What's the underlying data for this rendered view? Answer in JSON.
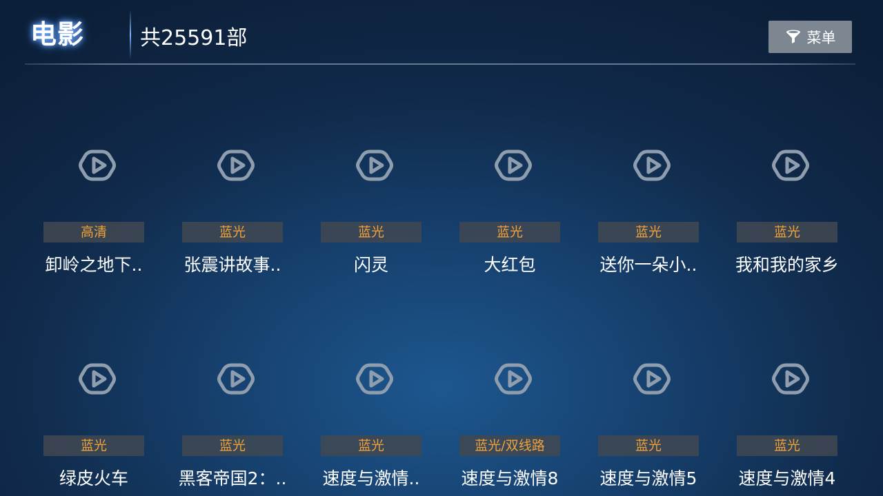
{
  "header": {
    "title": "电影",
    "count": "共25591部",
    "menu_label": "菜单"
  },
  "movies": [
    {
      "badge": "高清",
      "title": "卸岭之地下.."
    },
    {
      "badge": "蓝光",
      "title": "张震讲故事.."
    },
    {
      "badge": "蓝光",
      "title": "闪灵"
    },
    {
      "badge": "蓝光",
      "title": "大红包"
    },
    {
      "badge": "蓝光",
      "title": "送你一朵小.."
    },
    {
      "badge": "蓝光",
      "title": "我和我的家乡"
    },
    {
      "badge": "蓝光",
      "title": "绿皮火车"
    },
    {
      "badge": "蓝光",
      "title": "黑客帝国2：.."
    },
    {
      "badge": "蓝光",
      "title": "速度与激情.."
    },
    {
      "badge": "蓝光/双线路",
      "title": "速度与激情8"
    },
    {
      "badge": "蓝光",
      "title": "速度与激情5"
    },
    {
      "badge": "蓝光",
      "title": "速度与激情4"
    }
  ],
  "colors": {
    "badge_text": "#f0a23a",
    "icon": "#8f9eae"
  },
  "icons": {
    "menu": "filter-icon",
    "poster_placeholder": "play-icon"
  }
}
